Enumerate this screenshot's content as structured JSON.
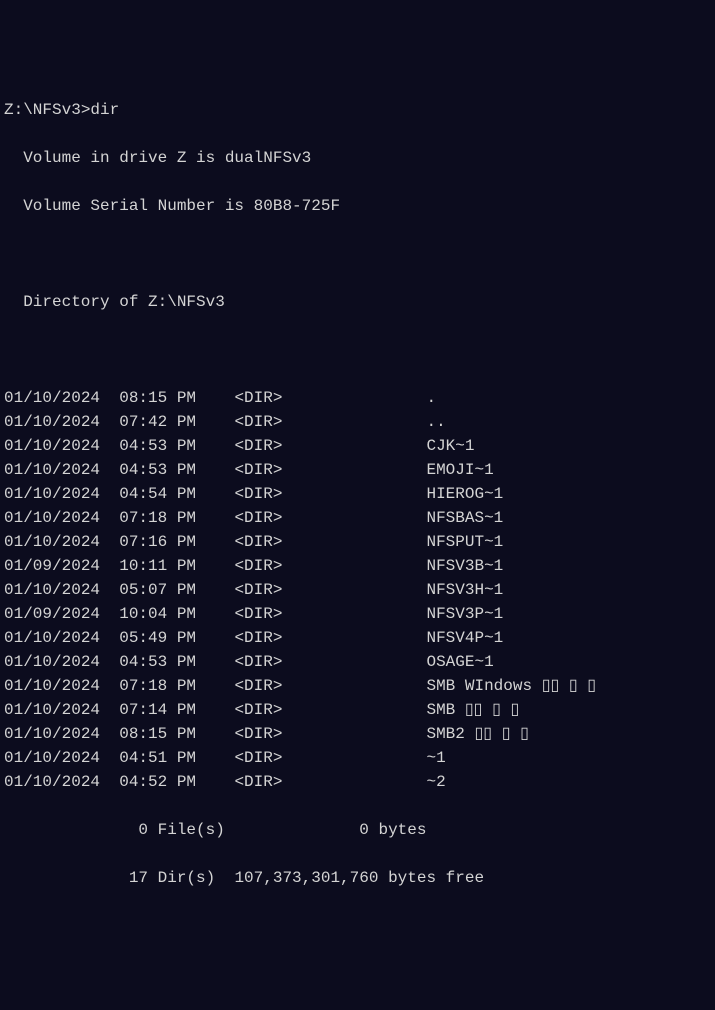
{
  "prompt": "Z:\\NFSv3>",
  "command": "dir",
  "volume_line": " Volume in drive Z is dualNFSv3",
  "serial_line": " Volume Serial Number is 80B8-725F",
  "directory_line": " Directory of Z:\\NFSv3",
  "entries": [
    {
      "date": "01/10/2024",
      "time": "08:15 PM",
      "type": "<DIR>",
      "size": "",
      "name": "."
    },
    {
      "date": "01/10/2024",
      "time": "07:42 PM",
      "type": "<DIR>",
      "size": "",
      "name": ".."
    },
    {
      "date": "01/10/2024",
      "time": "04:53 PM",
      "type": "<DIR>",
      "size": "",
      "name": "CJK~1"
    },
    {
      "date": "01/10/2024",
      "time": "04:53 PM",
      "type": "<DIR>",
      "size": "",
      "name": "EMOJI~1"
    },
    {
      "date": "01/10/2024",
      "time": "04:54 PM",
      "type": "<DIR>",
      "size": "",
      "name": "HIEROG~1"
    },
    {
      "date": "01/10/2024",
      "time": "07:18 PM",
      "type": "<DIR>",
      "size": "",
      "name": "NFSBAS~1"
    },
    {
      "date": "01/10/2024",
      "time": "07:16 PM",
      "type": "<DIR>",
      "size": "",
      "name": "NFSPUT~1"
    },
    {
      "date": "01/09/2024",
      "time": "10:11 PM",
      "type": "<DIR>",
      "size": "",
      "name": "NFSV3B~1"
    },
    {
      "date": "01/10/2024",
      "time": "05:07 PM",
      "type": "<DIR>",
      "size": "",
      "name": "NFSV3H~1"
    },
    {
      "date": "01/09/2024",
      "time": "10:04 PM",
      "type": "<DIR>",
      "size": "",
      "name": "NFSV3P~1"
    },
    {
      "date": "01/10/2024",
      "time": "05:49 PM",
      "type": "<DIR>",
      "size": "",
      "name": "NFSV4P~1"
    },
    {
      "date": "01/10/2024",
      "time": "04:53 PM",
      "type": "<DIR>",
      "size": "",
      "name": "OSAGE~1"
    },
    {
      "date": "01/10/2024",
      "time": "07:18 PM",
      "type": "<DIR>",
      "size": "",
      "name": "SMB WIndows ▯▯ ▯ ▯"
    },
    {
      "date": "01/10/2024",
      "time": "07:14 PM",
      "type": "<DIR>",
      "size": "",
      "name": "SMB ▯▯ ▯ ▯"
    },
    {
      "date": "01/10/2024",
      "time": "08:15 PM",
      "type": "<DIR>",
      "size": "",
      "name": "SMB2 ▯▯ ▯ ▯"
    },
    {
      "date": "01/10/2024",
      "time": "04:51 PM",
      "type": "<DIR>",
      "size": "",
      "name": "~1"
    },
    {
      "date": "01/10/2024",
      "time": "04:52 PM",
      "type": "<DIR>",
      "size": "",
      "name": "~2"
    }
  ],
  "summary_files": "              0 File(s)              0 bytes",
  "summary_dirs": "             17 Dir(s)  107,373,301,760 bytes free"
}
